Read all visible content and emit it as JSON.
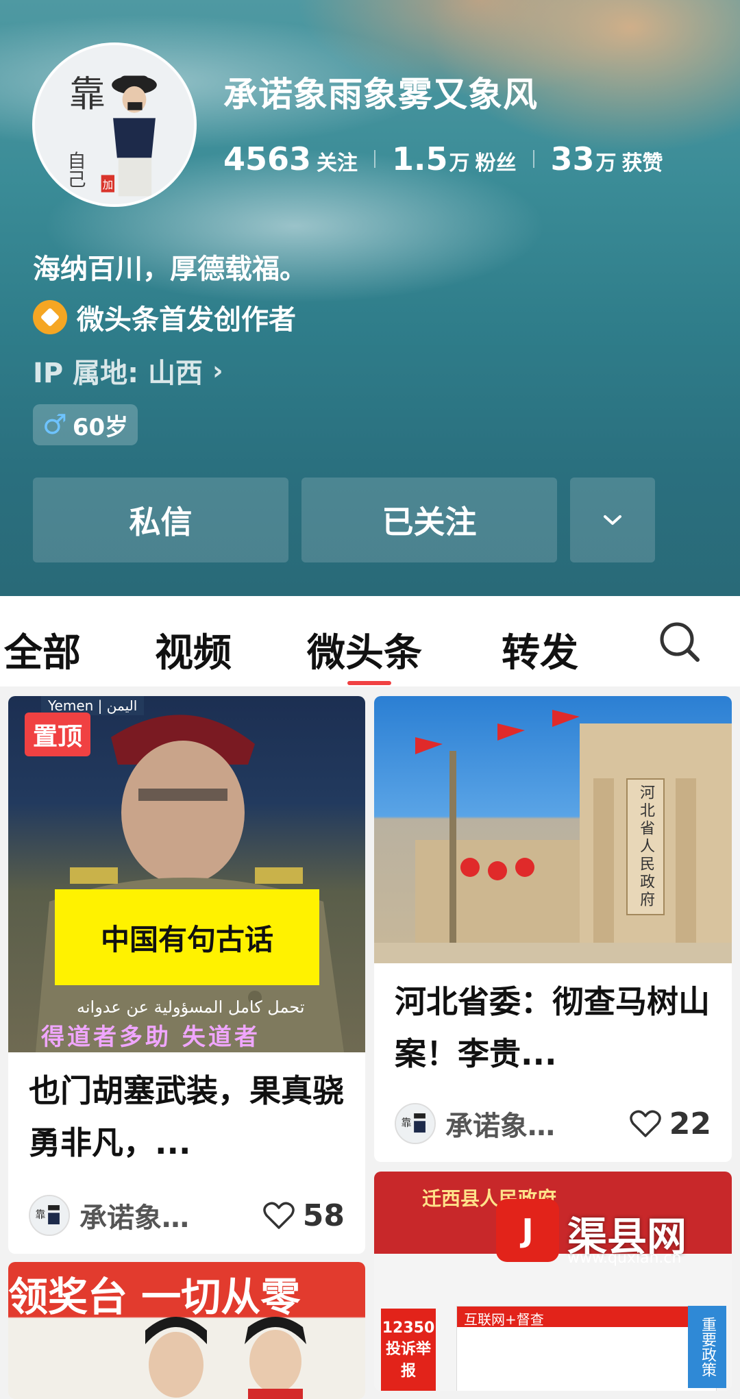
{
  "profile": {
    "username": "承诺象雨象雾又象风",
    "stats": {
      "following": {
        "value": "4563",
        "unit": "",
        "label": "关注"
      },
      "followers": {
        "value": "1.5",
        "unit": "万",
        "label": "粉丝"
      },
      "likes": {
        "value": "33",
        "unit": "万",
        "label": "获赞"
      }
    },
    "bio": "海纳百川，厚德载福。",
    "creator_label": "微头条首发创作者",
    "ip_location": "IP 属地: 山西",
    "age": "60岁",
    "avatar_text": {
      "top": "靠",
      "bottom": "自己",
      "stamp": "加"
    },
    "buttons": {
      "message": "私信",
      "follow": "已关注",
      "more": "⌄"
    }
  },
  "tabs": [
    {
      "label": "全部",
      "active": false
    },
    {
      "label": "视频",
      "active": false
    },
    {
      "label": "微头条",
      "active": true
    },
    {
      "label": "转发",
      "active": false
    }
  ],
  "colors": {
    "accent": "#f04142",
    "header_teal": "#2f7d8a",
    "badge_orange": "#f5a623"
  },
  "feed": {
    "cards": [
      {
        "pinned_label": "置顶",
        "title": "也门胡塞武装，果真骁勇非凡，...",
        "author": "承诺象…",
        "likes": "58",
        "image": {
          "yellow_text": "中国有句古话",
          "top_tag": "Yemen | اليمن",
          "arabic": "تحمل كامل المسؤولية عن عدوانه",
          "pink_text": "得道者多助 失道者"
        }
      },
      {
        "title": "河北省委：彻查马树山案！李贵...",
        "author": "承诺象…",
        "likes": "22",
        "image": {
          "sign_text": "河北省人民政府"
        }
      },
      {
        "image": {
          "site_title": "迁西县人民政府",
          "logo_text": "渠县网",
          "logo_url": "www.quxian.cn",
          "hotline": "12350 投诉举报",
          "news_head": "互联网+督查",
          "side_text": "重要政策"
        }
      },
      {
        "image": {
          "banner_text": "领奖台 一切从零"
        }
      }
    ]
  }
}
